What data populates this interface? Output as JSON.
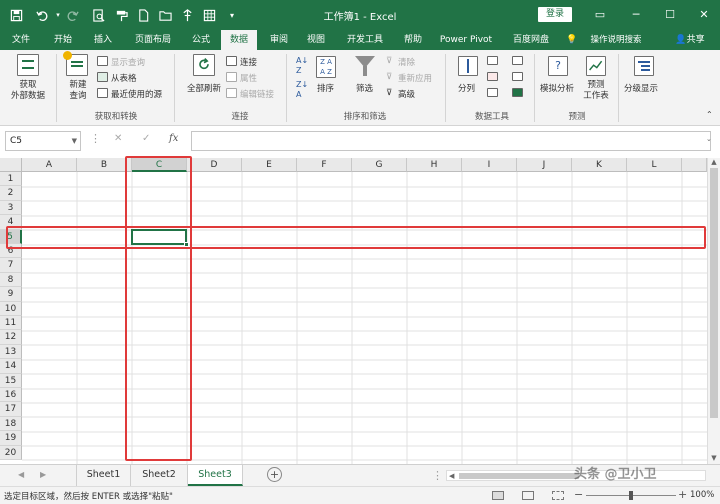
{
  "titlebar": {
    "title": "工作簿1  -  Excel",
    "login_label": "登录",
    "wc_restore": "▭",
    "wc_min": "─",
    "wc_max": "☐",
    "wc_close": "✕"
  },
  "tabs": [
    "文件",
    "开始",
    "插入",
    "页面布局",
    "公式",
    "数据",
    "审阅",
    "视图",
    "开发工具",
    "帮助",
    "Power Pivot",
    "百度网盘"
  ],
  "active_tab": "数据",
  "tell_me": "操作说明搜索",
  "share": "共享",
  "ribbon": {
    "get_data": {
      "line1": "获取",
      "line2": "外部数据"
    },
    "new_query": {
      "line1": "新建",
      "line2": "查询"
    },
    "show_queries": "显示查询",
    "from_table": "从表格",
    "recent_sources": "最近使用的源",
    "group_get": "获取和转换",
    "refresh_all": "全部刷新",
    "connections": "连接",
    "properties": "属性",
    "edit_links": "编辑链接",
    "group_conn": "连接",
    "sort": "排序",
    "filter": "筛选",
    "clear": "清除",
    "reapply": "重新应用",
    "advanced": "高级",
    "group_sort": "排序和筛选",
    "text_to_columns": "分列",
    "group_tools": "数据工具",
    "what_if": "模拟分析",
    "forecast": {
      "line1": "预测",
      "line2": "工作表"
    },
    "group_forecast": "预测",
    "outline": "分级显示"
  },
  "formula_bar": {
    "name_box": "C5",
    "cancel": "✕",
    "enter": "✓",
    "fx": "fx"
  },
  "columns": [
    "A",
    "B",
    "C",
    "D",
    "E",
    "F",
    "G",
    "H",
    "I",
    "J",
    "K",
    "L"
  ],
  "rows": [
    "1",
    "2",
    "3",
    "4",
    "5",
    "6",
    "7",
    "8",
    "9",
    "10",
    "11",
    "12",
    "13",
    "14",
    "15",
    "16",
    "17",
    "18",
    "19",
    "20"
  ],
  "selected_cell": "C5",
  "sheets": [
    "Sheet1",
    "Sheet2",
    "Sheet3"
  ],
  "active_sheet": "Sheet3",
  "add_sheet": "+",
  "status": "选定目标区域，然后按 ENTER 或选择\"粘贴\"",
  "zoom": "100%",
  "zoom_minus": "−",
  "zoom_plus": "+",
  "watermark": "头条 @卫小卫",
  "colors": {
    "excel_green": "#217346",
    "highlight": "#e03a3a"
  }
}
